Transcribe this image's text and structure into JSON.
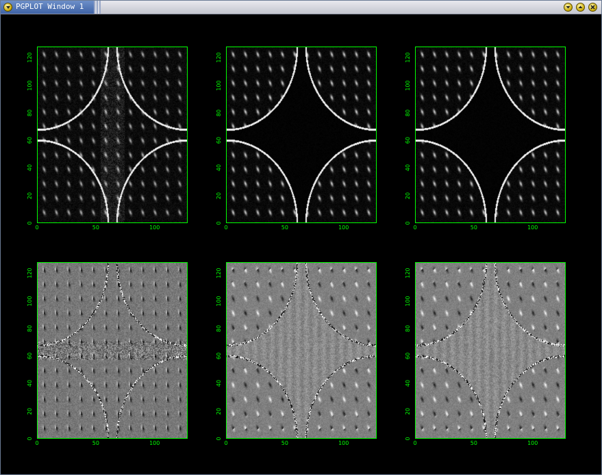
{
  "window": {
    "title": "PGPLOT Window 1",
    "icons": {
      "menu": "window-menu-icon",
      "minimize": "minimize-icon",
      "maximize": "maximize-icon",
      "close": "close-icon"
    }
  },
  "plot": {
    "axis_color": "#00ff00",
    "background": "#000000",
    "x_ticks": [
      "0",
      "50",
      "100"
    ],
    "y_ticks": [
      "0",
      "20",
      "40",
      "60",
      "80",
      "100",
      "120"
    ],
    "panels": [
      {
        "id": "top-left",
        "style": "dark",
        "variant": "inner-diamond"
      },
      {
        "id": "top-middle",
        "style": "dark",
        "variant": "quarter-circles"
      },
      {
        "id": "top-right",
        "style": "dark",
        "variant": "quarter-circles"
      },
      {
        "id": "bottom-left",
        "style": "gray",
        "variant": "inner-diamond"
      },
      {
        "id": "bottom-middle",
        "style": "gray",
        "variant": "quarter-circles"
      },
      {
        "id": "bottom-right",
        "style": "gray",
        "variant": "quarter-circles"
      }
    ]
  }
}
